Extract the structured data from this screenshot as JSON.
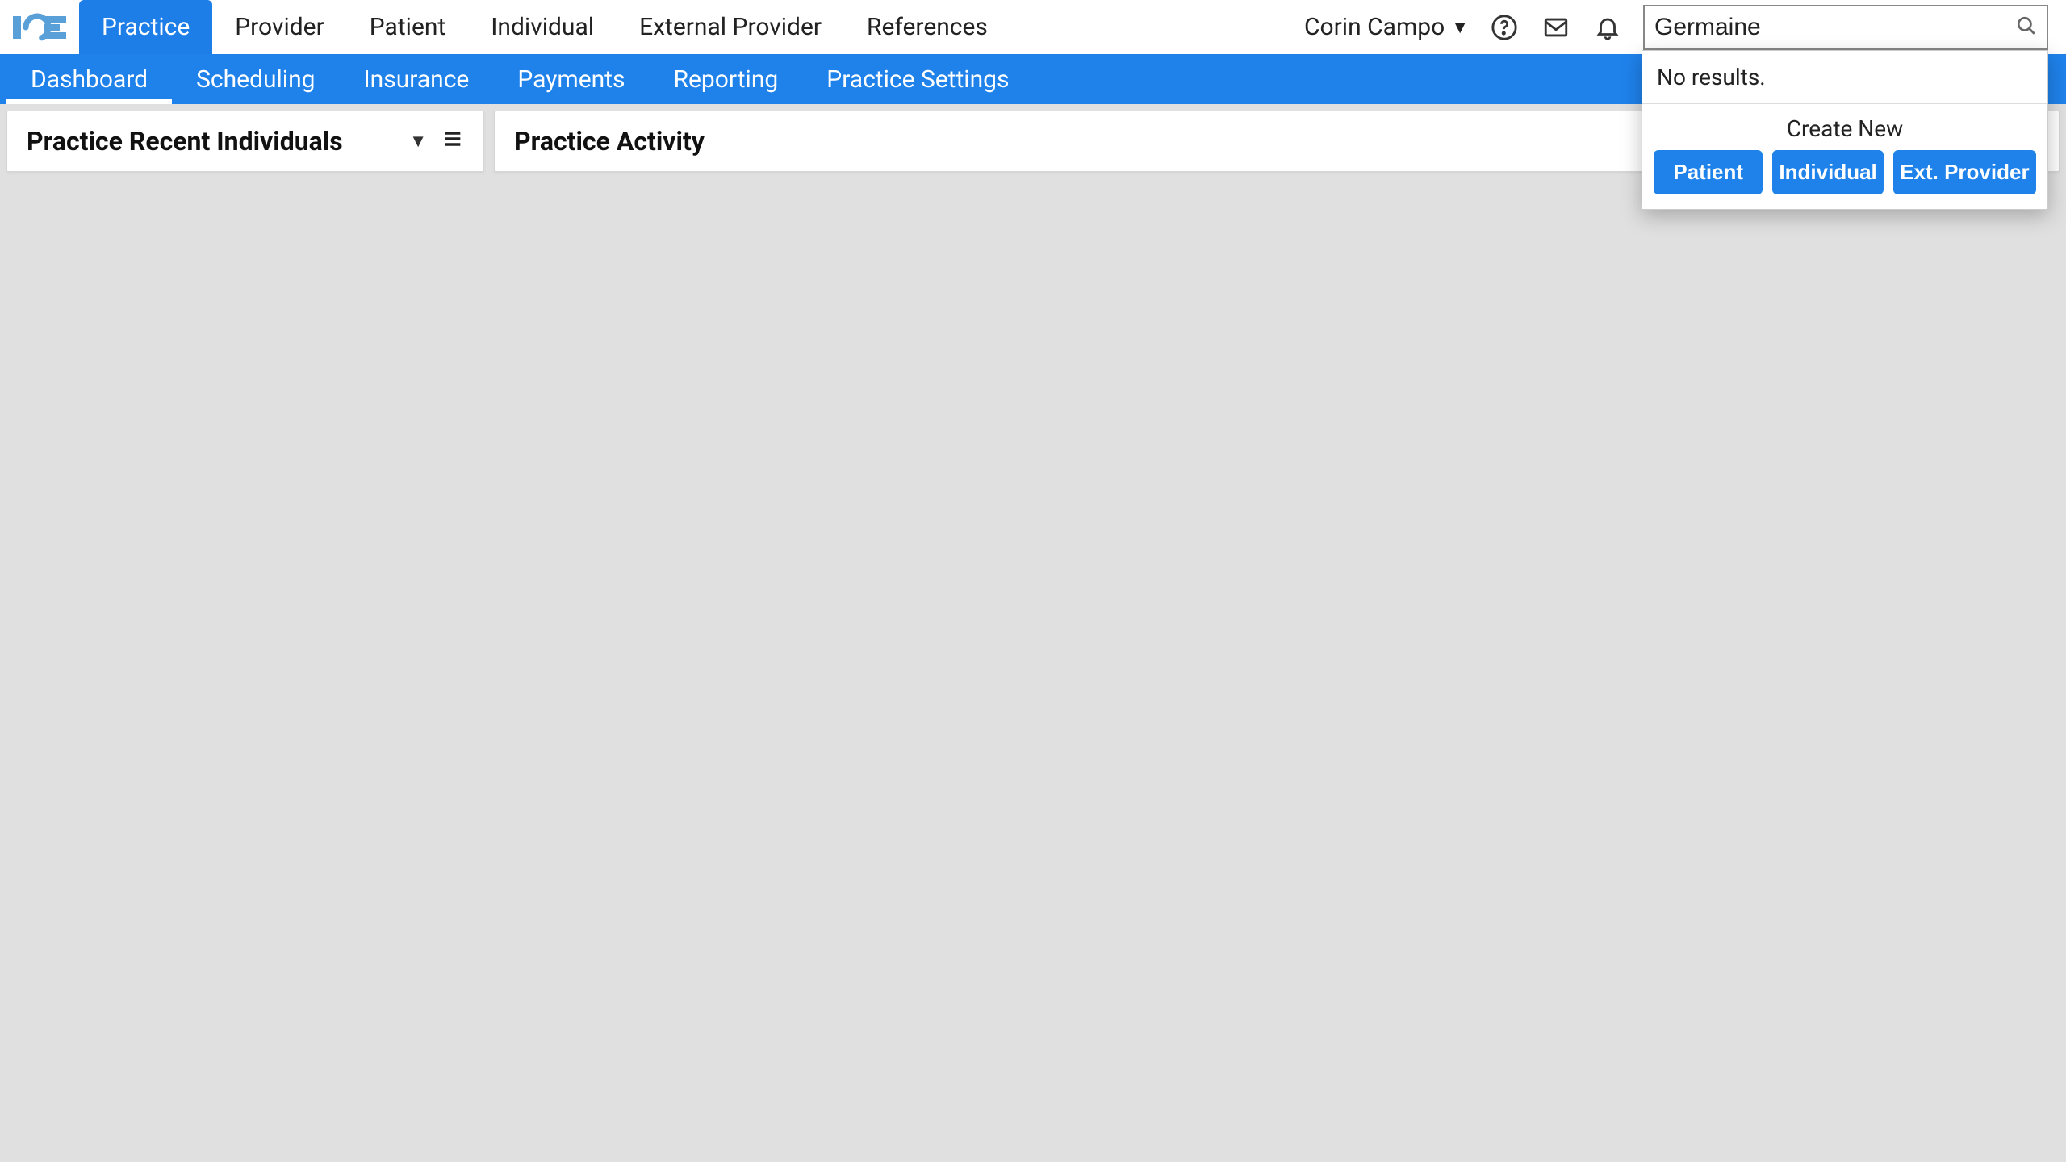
{
  "top_nav": {
    "tabs": [
      {
        "label": "Practice",
        "active": true
      },
      {
        "label": "Provider",
        "active": false
      },
      {
        "label": "Patient",
        "active": false
      },
      {
        "label": "Individual",
        "active": false
      },
      {
        "label": "External Provider",
        "active": false
      },
      {
        "label": "References",
        "active": false
      }
    ],
    "user_name": "Corin Campo",
    "search_value": "Germaine",
    "search_placeholder": ""
  },
  "search_dropdown": {
    "no_results_text": "No results.",
    "create_header": "Create New",
    "buttons": [
      {
        "label": "Patient"
      },
      {
        "label": "Individual"
      },
      {
        "label": "Ext. Provider"
      }
    ]
  },
  "sub_nav": {
    "tabs": [
      {
        "label": "Dashboard",
        "active": true
      },
      {
        "label": "Scheduling",
        "active": false
      },
      {
        "label": "Insurance",
        "active": false
      },
      {
        "label": "Payments",
        "active": false
      },
      {
        "label": "Reporting",
        "active": false
      },
      {
        "label": "Practice Settings",
        "active": false
      }
    ]
  },
  "panels": {
    "left_title": "Practice Recent Individuals",
    "right_title": "Practice Activity"
  }
}
